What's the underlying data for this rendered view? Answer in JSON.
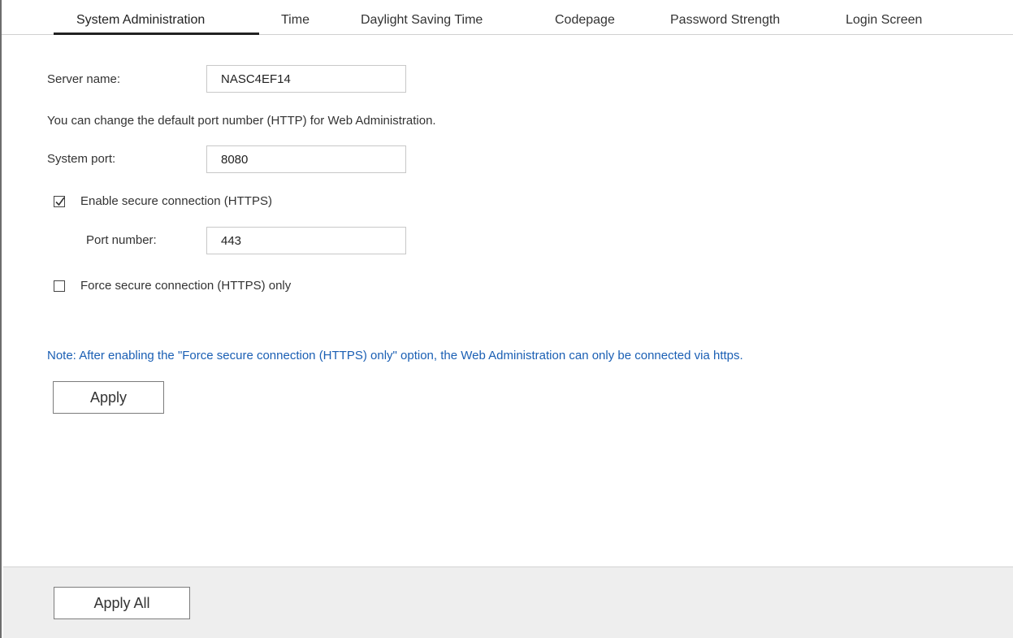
{
  "tabs": [
    {
      "label": "System Administration",
      "active": true
    },
    {
      "label": "Time"
    },
    {
      "label": "Daylight Saving Time"
    },
    {
      "label": "Codepage"
    },
    {
      "label": "Password Strength"
    },
    {
      "label": "Login Screen"
    }
  ],
  "form": {
    "server_name_label": "Server name:",
    "server_name_value": "NASC4EF14",
    "port_hint": "You can change the default port number (HTTP) for Web Administration.",
    "system_port_label": "System port:",
    "system_port_value": "8080",
    "https_label": "Enable secure connection (HTTPS)",
    "https_checked": true,
    "port_number_label": "Port number:",
    "port_number_value": "443",
    "force_https_label": "Force secure connection (HTTPS) only",
    "force_https_checked": false,
    "note": "Note: After enabling the \"Force secure connection (HTTPS) only\" option, the Web Administration can only be connected via https.",
    "apply_label": "Apply"
  },
  "footer": {
    "apply_all_label": "Apply All"
  },
  "colors": {
    "note": "#1a5fb4",
    "footer_bg": "#eeeeee",
    "active_tab_underline": "#222222"
  }
}
